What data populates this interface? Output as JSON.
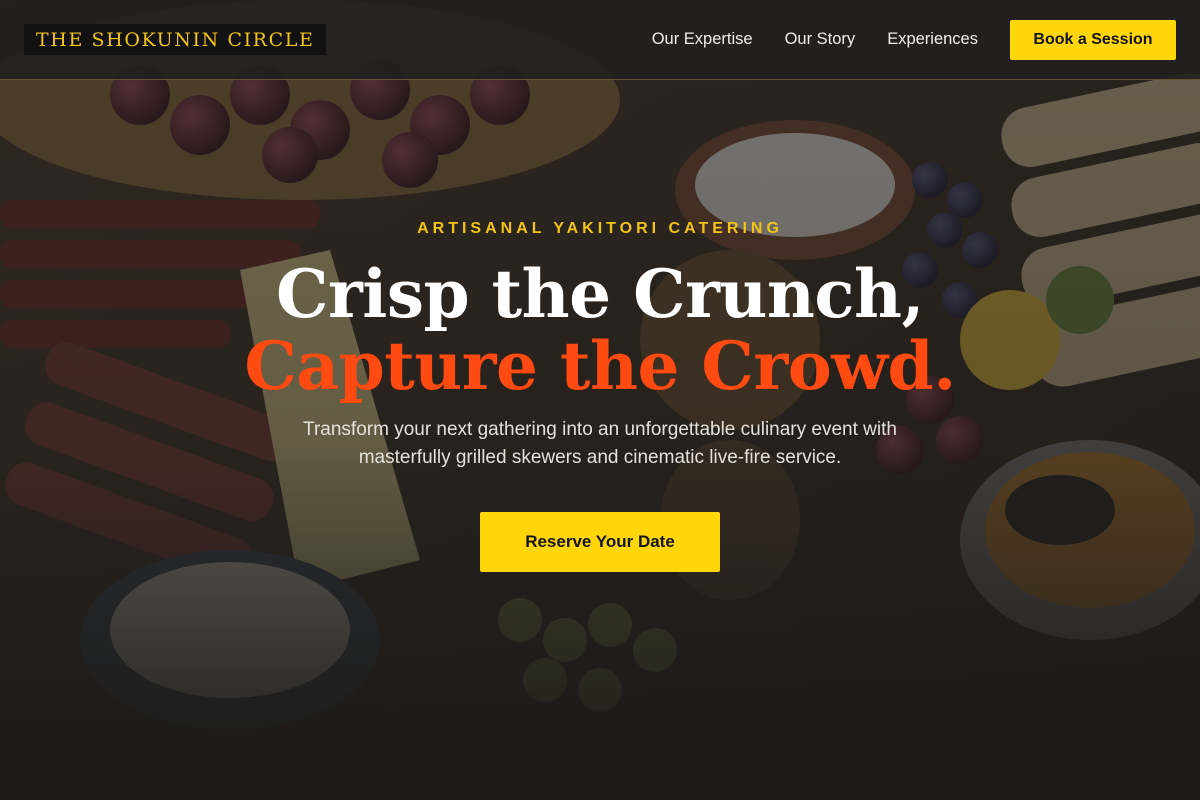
{
  "header": {
    "logo_text": "THE SHOKUNIN CIRCLE",
    "nav": [
      {
        "label": "Our Expertise"
      },
      {
        "label": "Our Story"
      },
      {
        "label": "Experiences"
      }
    ],
    "cta_label": "Book a Session"
  },
  "hero": {
    "eyebrow": "ARTISANAL YAKITORI CATERING",
    "headline_line1": "Crisp the Crunch,",
    "headline_line2": "Capture the Crowd.",
    "subtext": "Transform your next gathering into an unforgettable culinary event with masterfully grilled skewers and cinematic live-fire service.",
    "cta_label": "Reserve Your Date"
  },
  "colors": {
    "accent_yellow": "#ffd60a",
    "accent_orange": "#ff4a12",
    "logo_gold": "#f2c417",
    "background": "#1c1a18"
  }
}
